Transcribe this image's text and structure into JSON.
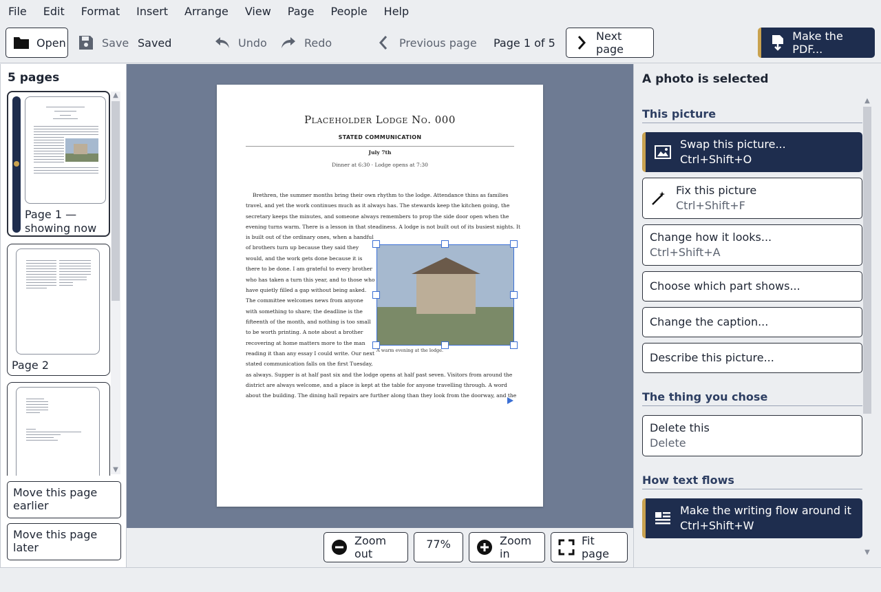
{
  "menu": [
    "File",
    "Edit",
    "Format",
    "Insert",
    "Arrange",
    "View",
    "Page",
    "People",
    "Help"
  ],
  "toolbar": {
    "open": "Open",
    "save": "Save",
    "saved": "Saved",
    "undo": "Undo",
    "redo": "Redo",
    "previous_page": "Previous page",
    "page_indicator": "Page 1 of 5",
    "next_page": "Next page",
    "make_pdf": "Make the PDF..."
  },
  "pages_panel": {
    "title": "5 pages",
    "pages": [
      {
        "label": "Page 1 — showing now"
      },
      {
        "label": "Page 2"
      },
      {
        "label": ""
      }
    ],
    "move_earlier": "Move this page earlier",
    "move_later": "Move this page later"
  },
  "document": {
    "title": "Placeholder Lodge No. 000",
    "subtitle": "STATED COMMUNICATION",
    "date": "July 7th",
    "dinner": "Dinner at 6:30 · Lodge opens at 7:30",
    "full_lines": [
      "Brethren, the summer months bring their own rhythm to the lodge. Attendance thins as families",
      "travel, and yet the work continues much as it always has. The stewards keep the kitchen going, the",
      "secretary keeps the minutes, and someone always remembers to prop the side door open when the",
      "evening turns warm. There is a lesson in that steadiness. A lodge is not built out of its busiest nights. It"
    ],
    "wrap_lines": [
      "is built out of the ordinary ones, when a handful",
      "of brothers turn up because they said they",
      "would, and the work gets done because it is",
      "there to be done. I am grateful to every brother",
      "who has taken a turn this year, and to those who",
      "have quietly filled a gap without being asked.",
      "The committee welcomes news from anyone",
      "with something to share; the deadline is the",
      "fifteenth of the month, and nothing is too small",
      "to be worth printing. A note about a brother",
      "recovering at home matters more to the man",
      "reading it than any essay I could write. Our next",
      "stated communication falls on the first Tuesday,"
    ],
    "after_lines": [
      "as always. Supper is at half past six and the lodge opens at half past seven. Visitors from around the",
      "district are always welcome, and a place is kept at the table for anyone travelling through. A word",
      "about the building. The dining hall repairs are further along than they look from the doorway, and the"
    ],
    "caption": "A warm evening at the lodge."
  },
  "zoom": {
    "zoom_out": "Zoom out",
    "level": "77%",
    "zoom_in": "Zoom in",
    "fit_page": "Fit page"
  },
  "properties": {
    "title": "A photo is selected",
    "sections": {
      "picture": "This picture",
      "chosen": "The thing you chose",
      "flow": "How text flows"
    },
    "actions": {
      "swap": {
        "label": "Swap this picture...",
        "shortcut": "Ctrl+Shift+O"
      },
      "fix": {
        "label": "Fix this picture",
        "shortcut": "Ctrl+Shift+F"
      },
      "looks": {
        "label": "Change how it looks...",
        "shortcut": "Ctrl+Shift+A"
      },
      "crop": {
        "label": "Choose which part shows..."
      },
      "caption": {
        "label": "Change the caption..."
      },
      "describe": {
        "label": "Describe this picture..."
      },
      "delete": {
        "label": "Delete this",
        "shortcut": "Delete"
      },
      "wrap": {
        "label": "Make the writing flow around it",
        "shortcut": "Ctrl+Shift+W"
      }
    }
  },
  "colors": {
    "primary": "#1e2d4e",
    "accent": "#c9a24f",
    "selection": "#3b6fd4",
    "canvas": "#6e7b93"
  }
}
